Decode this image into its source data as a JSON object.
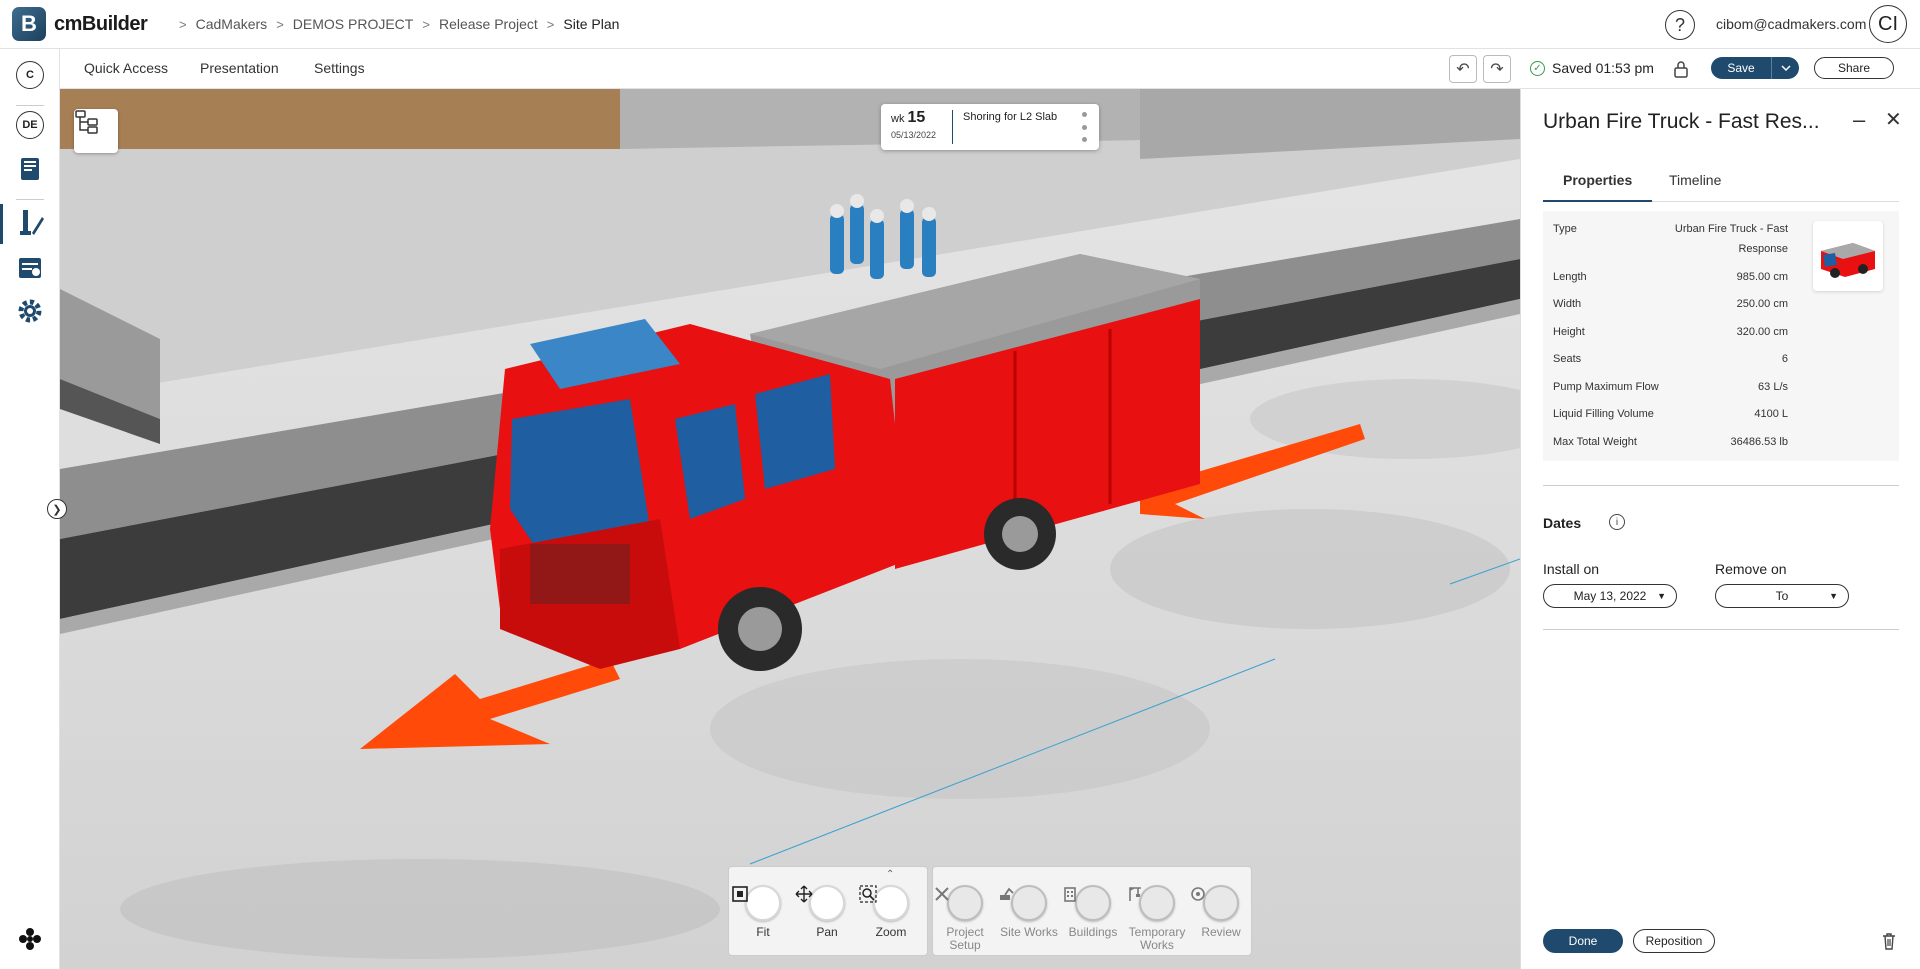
{
  "app": {
    "name": "cmBuilder",
    "logo_letter": "B"
  },
  "breadcrumb": [
    "CadMakers",
    "DEMOS PROJECT",
    "Release Project",
    "Site Plan"
  ],
  "header": {
    "help_glyph": "?",
    "user_email": "cibom@cadmakers.com",
    "avatar_initials": "CI"
  },
  "left_rail": {
    "top_badge": "C",
    "lang_badge": "DE"
  },
  "menu": {
    "items": [
      "Quick Access",
      "Presentation",
      "Settings"
    ]
  },
  "toolbar": {
    "saved_text": "Saved 01:53 pm",
    "save_label": "Save",
    "share_label": "Share"
  },
  "task": {
    "week_prefix": "wk",
    "week_number": "15",
    "date": "05/13/2022",
    "name": "Shoring for L2 Slab"
  },
  "view_tools": [
    {
      "label": "Fit",
      "icon": "fit-icon"
    },
    {
      "label": "Pan",
      "icon": "pan-icon"
    },
    {
      "label": "Zoom",
      "icon": "zoom-icon"
    }
  ],
  "categories": [
    {
      "label_1": "Project",
      "label_2": "Setup",
      "icon": "tools-icon"
    },
    {
      "label_1": "Site Works",
      "label_2": "",
      "icon": "excavator-icon"
    },
    {
      "label_1": "Buildings",
      "label_2": "",
      "icon": "building-icon"
    },
    {
      "label_1": "Temporary",
      "label_2": "Works",
      "icon": "crane-icon"
    },
    {
      "label_1": "Review",
      "label_2": "",
      "icon": "review-icon"
    }
  ],
  "panel": {
    "title": "Urban Fire Truck - Fast Res...",
    "tabs": [
      "Properties",
      "Timeline"
    ],
    "active_tab": "Properties",
    "properties": [
      {
        "key": "Type",
        "value": "Urban Fire Truck - Fast Response"
      },
      {
        "key": "Length",
        "value": "985.00 cm"
      },
      {
        "key": "Width",
        "value": "250.00 cm"
      },
      {
        "key": "Height",
        "value": "320.00 cm"
      },
      {
        "key": "Seats",
        "value": "6"
      },
      {
        "key": "Pump Maximum Flow",
        "value": "63 L/s"
      },
      {
        "key": "Liquid Filling Volume",
        "value": "4100 L"
      },
      {
        "key": "Max Total Weight",
        "value": "36486.53 lb"
      }
    ],
    "dates_title": "Dates",
    "install_label": "Install on",
    "install_value": "May 13, 2022",
    "remove_label": "Remove on",
    "remove_value": "To",
    "done_label": "Done",
    "reposition_label": "Reposition"
  },
  "colors": {
    "primary": "#1f4a6e",
    "truck_red": "#e81010",
    "arrow_orange": "#ff4a0a",
    "saved_green": "#3a9a4e"
  }
}
